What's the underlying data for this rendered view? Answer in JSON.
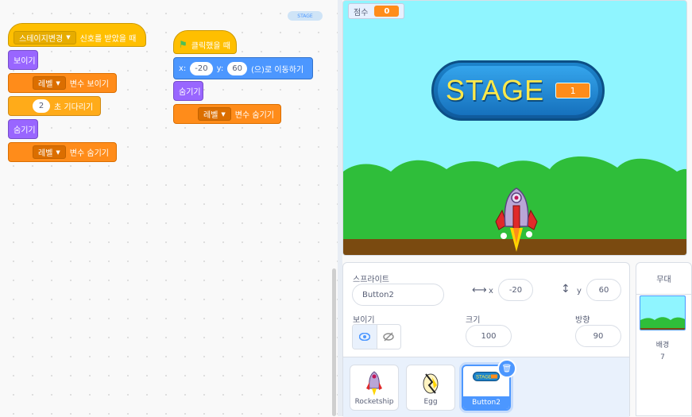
{
  "code": {
    "mini_stage_label": "STAGE",
    "script1": {
      "hat_dropdown": "스테이지변경",
      "hat_text": "신호를 받았을 때",
      "show": "보이기",
      "show_var_dropdown": "레벨",
      "show_var_text": "변수 보이기",
      "wait_value": "2",
      "wait_text": "초 기다리기",
      "hide": "숨기기",
      "hide_var_dropdown": "레벨",
      "hide_var_text": "변수 숨기기"
    },
    "script2": {
      "hat_text": "클릭했을 때",
      "x_label": "x:",
      "x_value": "-20",
      "y_label": "y:",
      "y_value": "60",
      "goto_text": "(으)로 이동하기",
      "hide": "숨기기",
      "hide_var_dropdown": "레벨",
      "hide_var_text": "변수 숨기기"
    }
  },
  "stage": {
    "monitor_label": "점수",
    "monitor_value": "0",
    "button_word": "STAGE",
    "button_level": "1"
  },
  "sprite_info": {
    "sprite_label": "스프라이트",
    "sprite_name": "Button2",
    "x_label": "x",
    "x_value": "-20",
    "y_label": "y",
    "y_value": "60",
    "show_label": "보이기",
    "size_label": "크기",
    "size_value": "100",
    "direction_label": "방향",
    "direction_value": "90"
  },
  "sprites": [
    {
      "name": "Rocketship"
    },
    {
      "name": "Egg"
    },
    {
      "name": "Button2",
      "selected": true
    }
  ],
  "thumb_stage_label": "STAGE",
  "stage_pane": {
    "title": "무대",
    "backdrop_label": "배경",
    "backdrop_count": "7"
  },
  "colors": {
    "events": "#ffbf00",
    "looks": "#9966ff",
    "variables": "#ff8c1a",
    "control": "#ffab19",
    "motion": "#4c97ff",
    "stage_sky": "#8ff5ff",
    "grass": "#2fbe3a",
    "ground": "#7a4a10"
  }
}
